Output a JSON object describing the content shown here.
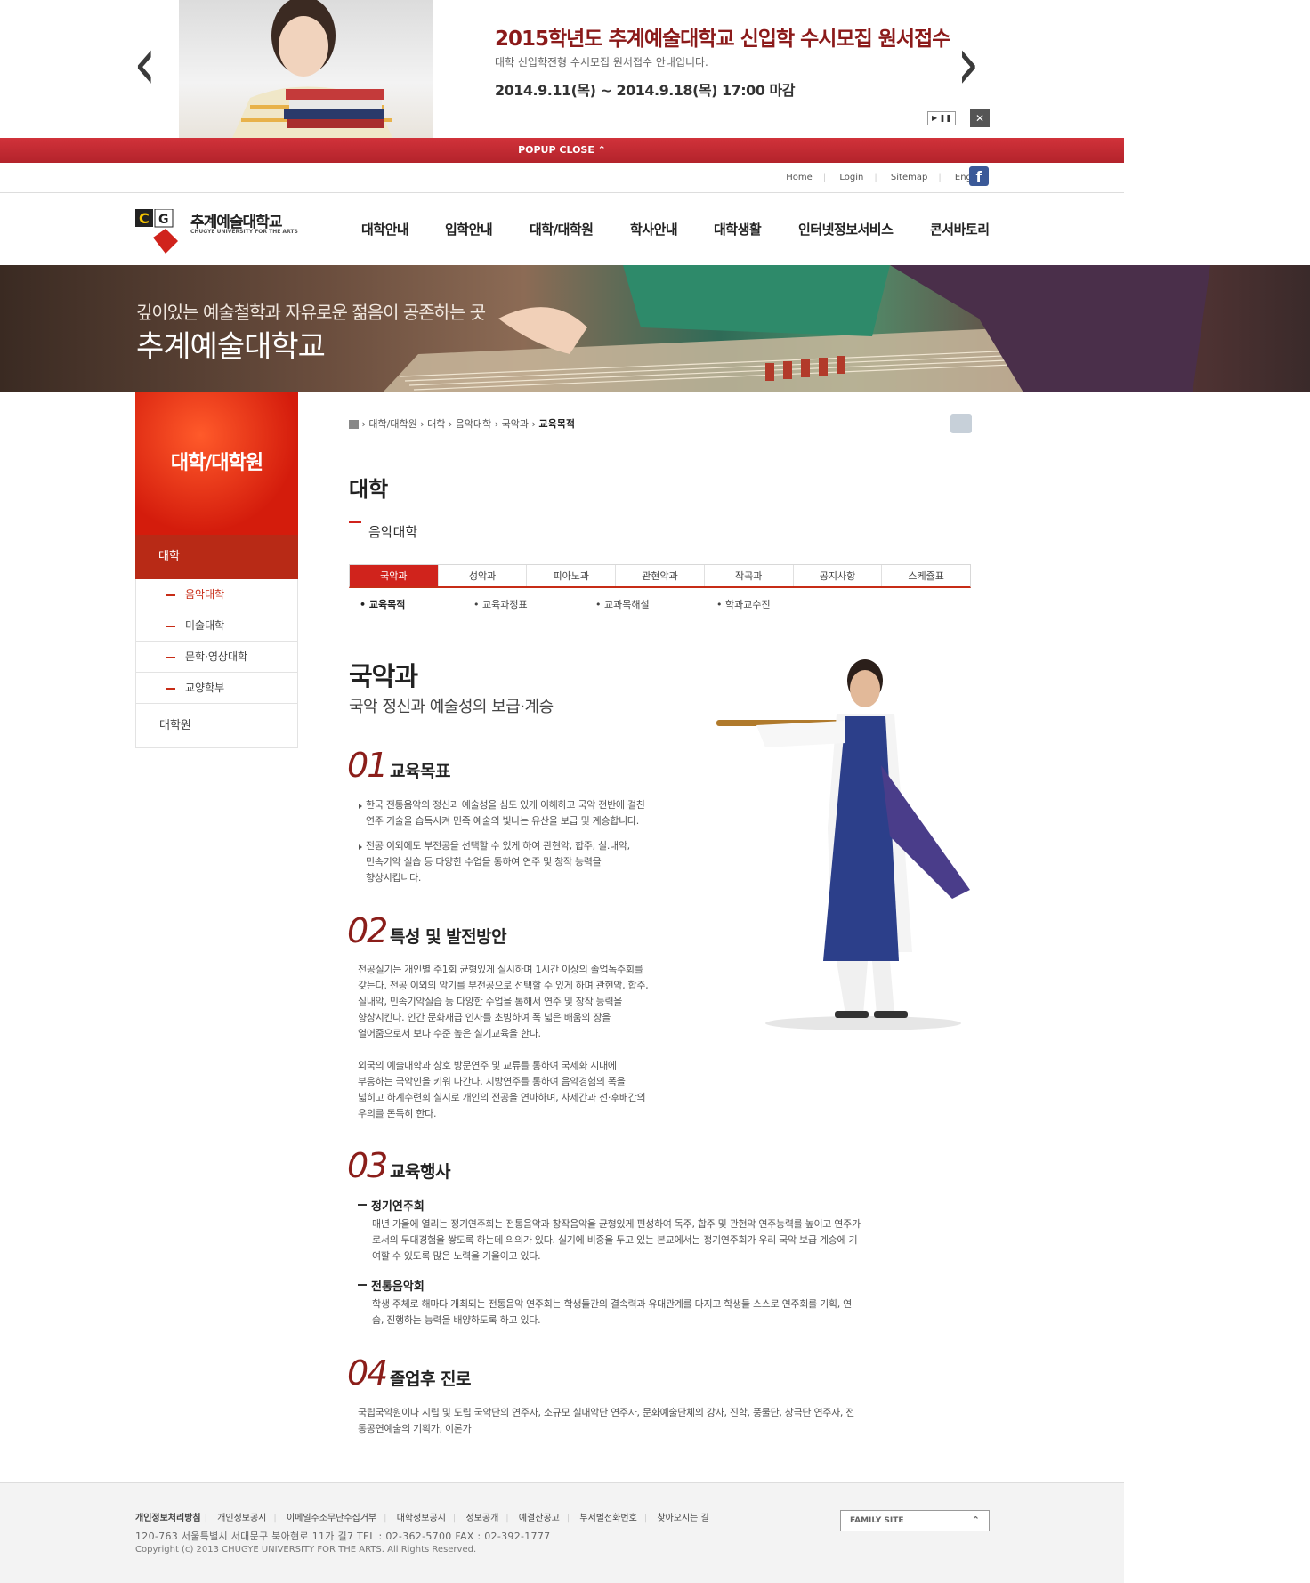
{
  "popup": {
    "title": "2015학년도 추계예술대학교 신입학 수시모집 원서접수",
    "subtitle": "대학 신입학전형 수시모집 원서접수 안내입니다.",
    "date": "2014.9.11(목) ~ 2014.9.18(목) 17:00 마감",
    "prev_icon": "‹",
    "next_icon": "›",
    "play_pause": "▶ ❚❚",
    "close_icon": "✕",
    "bar_label": "POPUP CLOSE ⌃"
  },
  "util": {
    "links": [
      "Home",
      "Login",
      "Sitemap",
      "English"
    ],
    "facebook": "f"
  },
  "logo": {
    "name_ko": "추계예술대학교",
    "name_en": "CHUGYE UNIVERSITY FOR THE ARTS"
  },
  "gnb": [
    "대학안내",
    "입학안내",
    "대학/대학원",
    "학사안내",
    "대학생활",
    "인터넷정보서비스",
    "콘서바토리"
  ],
  "banner": {
    "subtitle": "깊이있는 예술철학과 자유로운 젊음이 공존하는 곳",
    "title": "추계예술대학교"
  },
  "lnb": {
    "title": "대학/대학원",
    "current": "대학",
    "sub": [
      "음악대학",
      "미술대학",
      "문학·영상대학",
      "교양학부"
    ],
    "grad": "대학원"
  },
  "breadcrumb": [
    "대학/대학원",
    "대학",
    "음악대학",
    "국악과",
    "교육목적"
  ],
  "page": {
    "title": "대학",
    "subtitle": "음악대학"
  },
  "tabs": [
    "국악과",
    "성악과",
    "피아노과",
    "관현악과",
    "작곡과",
    "공지사항",
    "스케쥴표"
  ],
  "subtabs": [
    "교육목적",
    "교육과정표",
    "교과목해설",
    "학과교수진"
  ],
  "dept": {
    "name": "국악과",
    "tagline": "국악 정신과 예술성의 보급·계승"
  },
  "sections": {
    "s1": {
      "num": "01",
      "title": "교육목표",
      "items": [
        [
          "한국 전통음악의 정신과 예술성을 심도 있게 이해하고 국악 전반에 걸친",
          "연주 기술을 습득시켜 민족 예술의 빛나는 유산을 보급 및 계승합니다."
        ],
        [
          "전공 이외에도 부전공을 선택할 수 있게 하여 관현악, 합주, 실.내악,",
          "민속기악 실습 등 다양한 수업을 통하여 연주 및 창작 능력을",
          "향상시킵니다."
        ]
      ]
    },
    "s2": {
      "num": "02",
      "title": "특성 및 발전방안",
      "p1": [
        "전공실기는 개인별 주1회 균형있게 실시하며 1시간 이상의 졸업독주회를",
        "갖는다. 전공 이외의 악기를 부전공으로 선택할 수 있게 하며 관현악, 합주,",
        "실내악, 민속기악실습 등 다양한 수업을 통해서 연주 및 창작 능력을",
        "향상시킨다. 인간 문화재급 인사를 초빙하여 폭 넓은 배움의 장을",
        "열어줌으로서 보다 수준 높은 실기교육을 한다."
      ],
      "p2": [
        "외국의 예술대학과 상호 방문연주 및 교류를 통하여 국제화 시대에",
        "부응하는 국악인을 키워 나간다. 지방연주를 통하여 음악경험의 폭을",
        "넓히고 하계수련회 실시로 개인의 전공을 연마하며, 사제간과 선·후배간의",
        "우의를 돈독히 한다."
      ]
    },
    "s3": {
      "num": "03",
      "title": "교육행사",
      "e1_title": "정기연주회",
      "e1": [
        "매년 가을에 열리는 정기연주회는 전통음악과 창작음악을 균형있게 편성하여 독주, 합주 및 관현악 연주능력를 높이고 연주가",
        "로서의 무대경험을 쌓도록 하는데 의의가 있다. 실기에 비중을 두고 있는 본교에서는 정기연주회가 우리 국악 보급 계승에 기",
        "여할 수 있도록 많은 노력을 기울이고 있다."
      ],
      "e2_title": "전통음악회",
      "e2": [
        "학생 주체로 해마다 개최되는 전통음악 연주회는 학생들간의 결속력과 유대관계를 다지고 학생들 스스로 연주회를 기획, 연",
        "습, 진행하는 능력을 배양하도록 하고 있다."
      ]
    },
    "s4": {
      "num": "04",
      "title": "졸업후 진로",
      "p": [
        "국립국악원이나 시립 및 도립 국악단의 연주자, 소규모 실내악단 연주자, 문화예술단체의 강사, 진학, 풍물단, 창극단 연주자, 전",
        "통공연예술의 기획가, 이론가"
      ]
    }
  },
  "footer": {
    "links": [
      "개인정보처리방침",
      "개인정보공시",
      "이메일주소무단수집거부",
      "대학정보공시",
      "정보공개",
      "예결산공고",
      "부서별전화번호",
      "찾아오시는 길"
    ],
    "address": "120-763 서울특별시 서대문구 북아현로 11가 길7 TEL : 02-362-5700 FAX : 02-392-1777",
    "copyright": "Copyright (c) 2013 CHUGYE UNIVERSITY FOR THE ARTS. All Rights Reserved.",
    "family_site": "FAMILY SITE"
  },
  "colors": {
    "accent": "#d0231c",
    "dark_red": "#8b1e1a",
    "popup_bar": "#c42a32"
  }
}
